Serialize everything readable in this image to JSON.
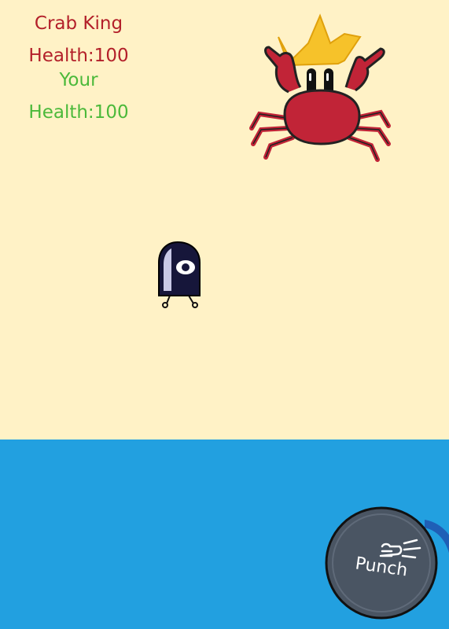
{
  "boss": {
    "name": "Crab King",
    "health_label": "Health:100"
  },
  "player": {
    "name": "Your",
    "health_label": "Health:100"
  },
  "controls": {
    "punch_label": "Punch"
  },
  "colors": {
    "sand": "#fff2c6",
    "sea": "#22a0e0",
    "boss_text": "#b3202a",
    "player_text": "#4bb93a",
    "crab_body": "#c12437",
    "crown": "#f6c22a",
    "button": "#4a5563"
  }
}
